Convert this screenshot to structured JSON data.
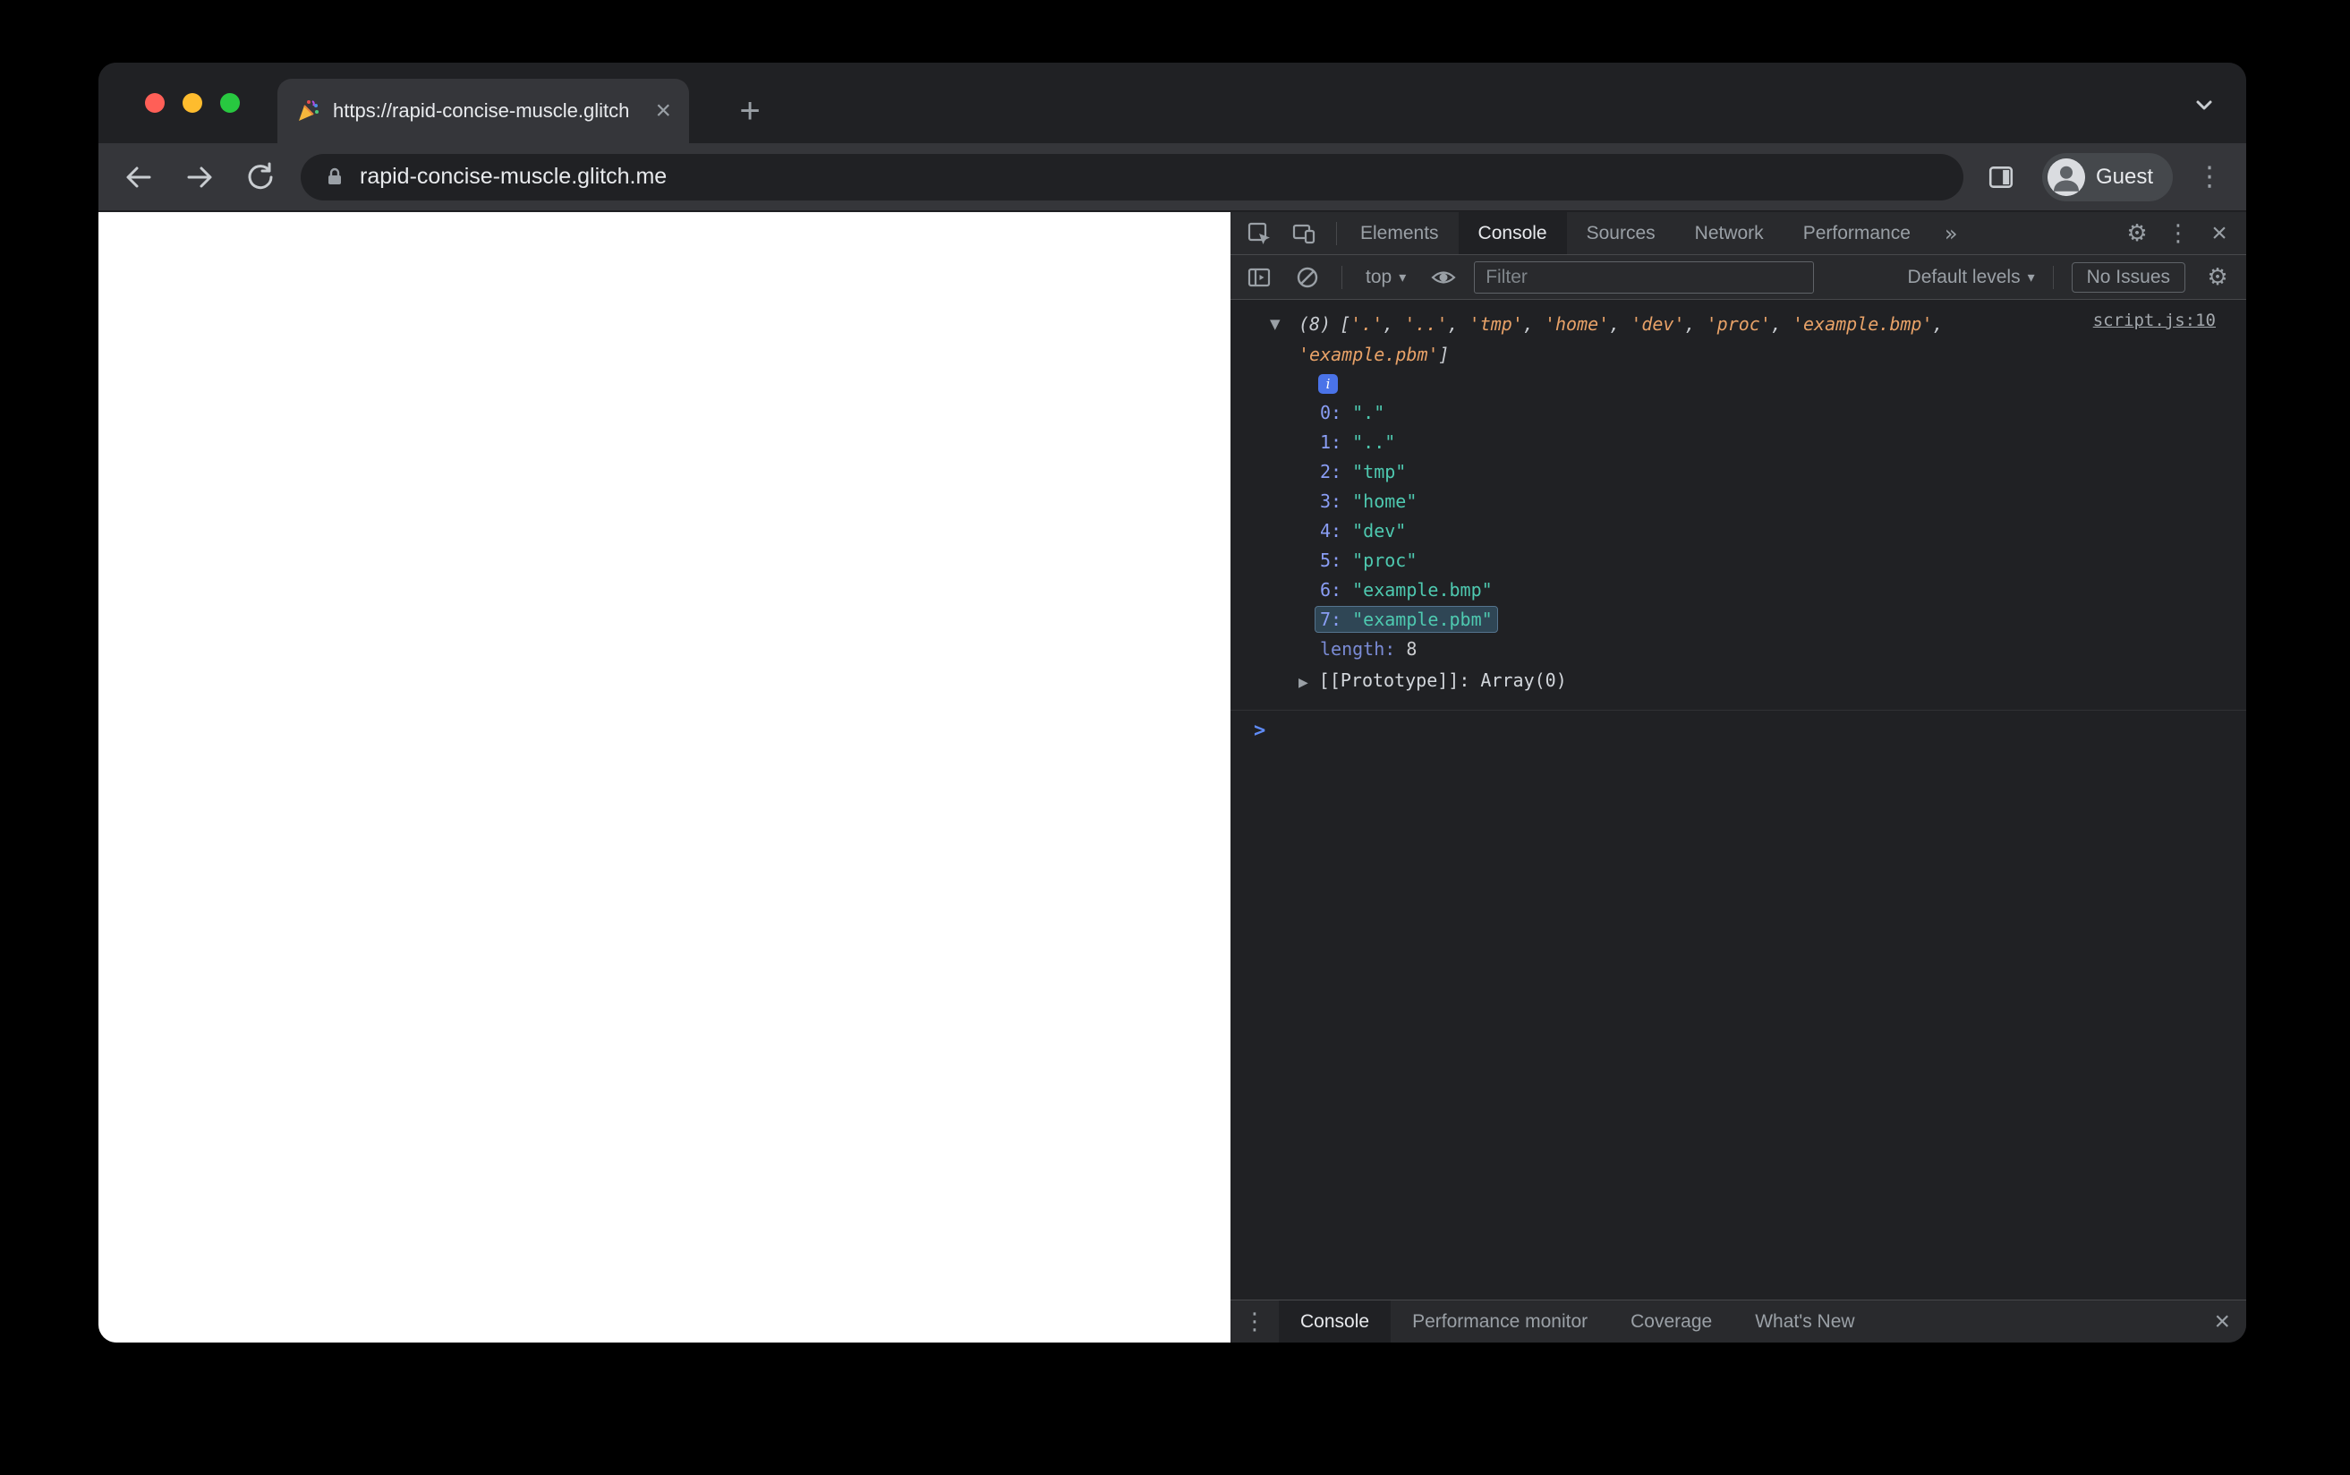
{
  "browser": {
    "tab_title": "https://rapid-concise-muscle.glitch.me",
    "url": "rapid-concise-muscle.glitch.me",
    "profile_label": "Guest"
  },
  "devtools": {
    "tabs": {
      "elements": "Elements",
      "console": "Console",
      "sources": "Sources",
      "network": "Network",
      "performance": "Performance"
    },
    "toolbar": {
      "context_label": "top",
      "filter_placeholder": "Filter",
      "levels_label": "Default levels",
      "issues_label": "No Issues"
    },
    "console": {
      "source_link": "script.js:10",
      "count": "(8)",
      "bracket_open": "[",
      "bracket_close": "]",
      "comma": ", ",
      "preview_items": [
        "'.'",
        "'..'",
        "'tmp'",
        "'home'",
        "'dev'",
        "'proc'",
        "'example.bmp'",
        "'example.pbm'"
      ],
      "entries": [
        {
          "index": "0:",
          "value": "\".\""
        },
        {
          "index": "1:",
          "value": "\"..\""
        },
        {
          "index": "2:",
          "value": "\"tmp\""
        },
        {
          "index": "3:",
          "value": "\"home\""
        },
        {
          "index": "4:",
          "value": "\"dev\""
        },
        {
          "index": "5:",
          "value": "\"proc\""
        },
        {
          "index": "6:",
          "value": "\"example.bmp\""
        },
        {
          "index": "7:",
          "value": "\"example.pbm\""
        }
      ],
      "length_label": "length:",
      "length_value": "8",
      "prototype_label": "[[Prototype]]:",
      "prototype_value": "Array(0)",
      "info_badge": "i",
      "prompt": ">"
    },
    "drawer": {
      "tabs": [
        "Console",
        "Performance monitor",
        "Coverage",
        "What's New"
      ]
    }
  },
  "icons": {
    "triangle_down": "▼",
    "triangle_right": "▶",
    "caret_down": "▾",
    "close": "×",
    "plus": "+",
    "kebab": "⋮",
    "gear": "⚙",
    "more_tabs": "»"
  },
  "colors": {
    "accent_blue": "#8ab4f8",
    "string_teal": "#4ec9b0",
    "preview_orange": "#e8a268",
    "index_blue": "#8a9ef5",
    "highlight_blue": "#5096be",
    "traffic_close": "#ff5f57",
    "traffic_minimize": "#febc2e",
    "traffic_zoom": "#28c840"
  }
}
